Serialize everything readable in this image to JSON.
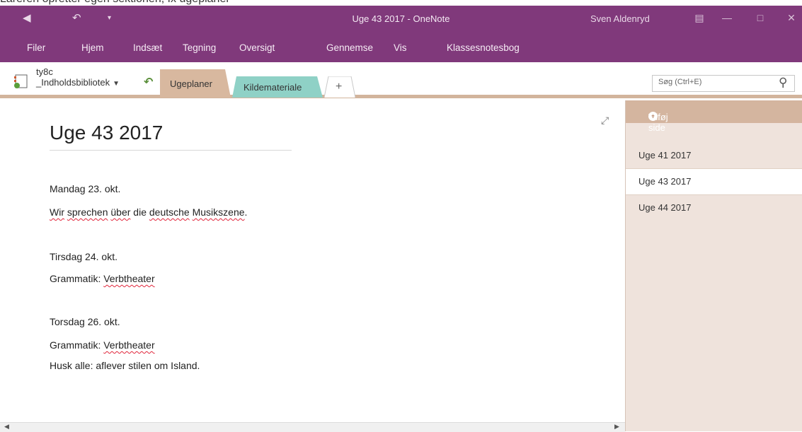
{
  "caption": "Lareren opretter egen sektionen, fx ugeplaner",
  "window": {
    "title": "Uge 43 2017  -  OneNote",
    "user": "Sven Aldenryd"
  },
  "ribbon_tabs": [
    "Filer",
    "Hjem",
    "Indsæt",
    "Tegning",
    "Oversigt",
    "Gennemse",
    "Vis",
    "Klassesnotesbog"
  ],
  "notebook": {
    "name_line1": "ty8c",
    "name_line2": "_Indholdsbibliotek"
  },
  "sections": [
    {
      "label": "Ugeplaner",
      "color": "#d8b89f",
      "active": true
    },
    {
      "label": "Kildemateriale",
      "color": "#8fd1c6",
      "active": false
    }
  ],
  "add_section_label": "+",
  "search": {
    "placeholder": "Søg (Ctrl+E)"
  },
  "page": {
    "title": "Uge 43 2017",
    "lines": [
      "Mandag 23. okt.",
      "Wir sprechen über die deutsche Musikszene.",
      "Tirsdag 24. okt.",
      "Grammatik: Verbtheater",
      "Torsdag 26. okt.",
      "Grammatik: Verbtheater",
      "Husk alle: aflever stilen om Island."
    ]
  },
  "pages_pane": {
    "add_page_label": "Tilføj side",
    "pages": [
      {
        "title": "Uge 41 2017",
        "active": false
      },
      {
        "title": "Uge 43 2017",
        "active": true
      },
      {
        "title": "Uge 44 2017",
        "active": false
      }
    ]
  },
  "colors": {
    "ribbon": "#80397b",
    "section_ugeplaner": "#d8b89f",
    "section_kildemateriale": "#8fd1c6",
    "pages_pane_bg": "#efe3dc",
    "spell_error": "#e0243a"
  }
}
